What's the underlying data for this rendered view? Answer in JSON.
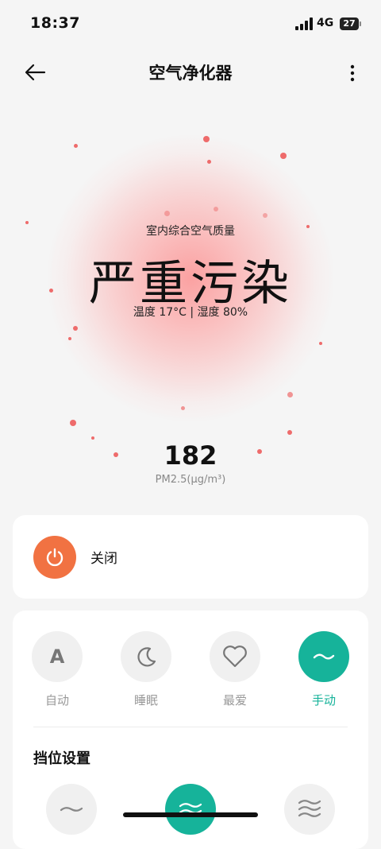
{
  "status": {
    "time": "18:37",
    "network": "4G",
    "battery": "27"
  },
  "header": {
    "title": "空气净化器",
    "back_icon": "arrow-left-icon",
    "more_icon": "more-vertical-icon"
  },
  "air": {
    "caption": "室内综合空气质量",
    "level": "严重污染",
    "env": "温度 17°C | 湿度 80%",
    "pm_value": "182",
    "pm_unit": "PM2.5(μg/m³)"
  },
  "power": {
    "label": "关闭",
    "icon": "power-icon",
    "color": "#f17242"
  },
  "modes": [
    {
      "label": "自动",
      "icon": "auto-a-icon",
      "glyph": "A",
      "active": false
    },
    {
      "label": "睡眠",
      "icon": "moon-icon",
      "active": false
    },
    {
      "label": "最爱",
      "icon": "heart-icon",
      "active": false
    },
    {
      "label": "手动",
      "icon": "wave-icon",
      "active": true
    }
  ],
  "gear": {
    "title": "挡位设置",
    "levels": [
      "low-wave-icon",
      "mid-wave-icon",
      "high-wave-icon"
    ],
    "active_index": 1
  },
  "colors": {
    "accent": "#16b39a",
    "danger_glow": "#ff6e6e",
    "power": "#f17242"
  }
}
